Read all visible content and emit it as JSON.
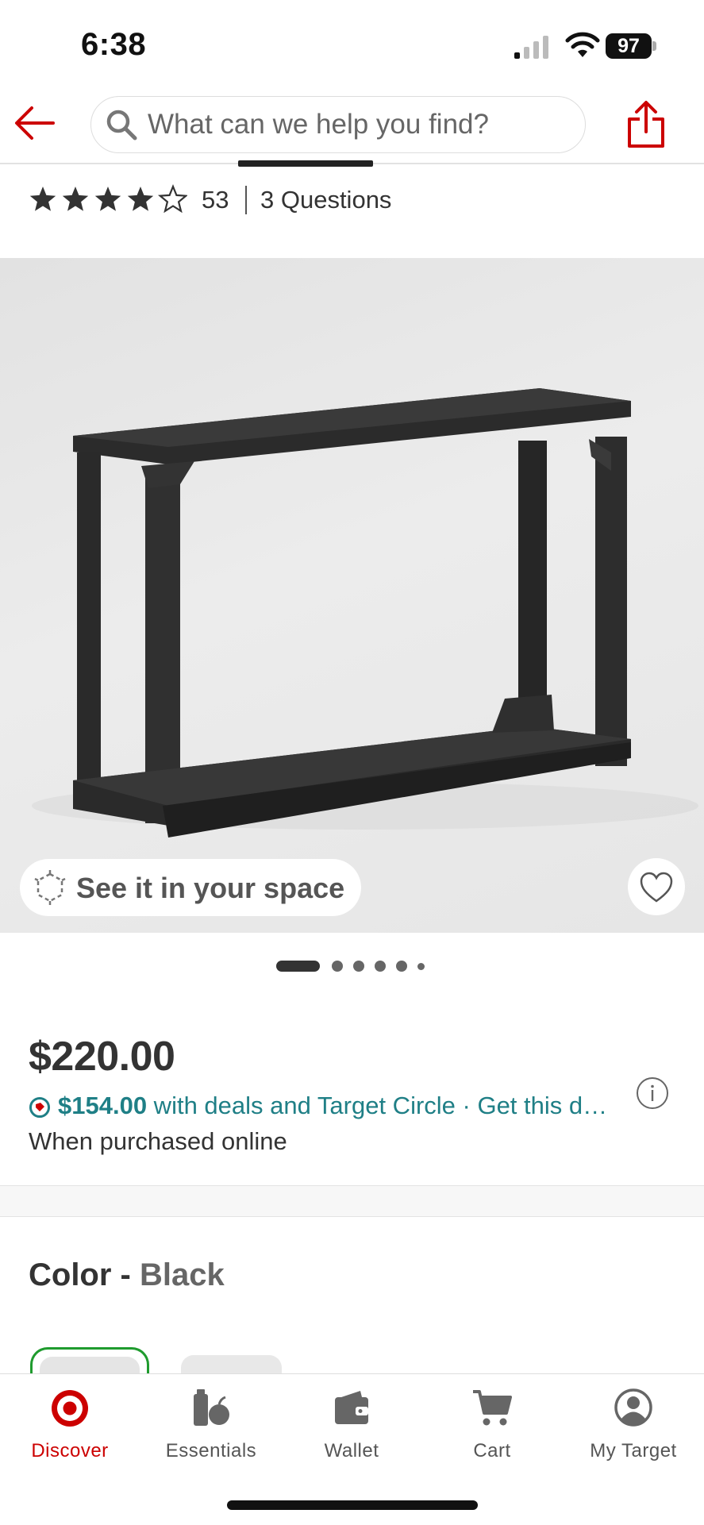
{
  "status_bar": {
    "time": "6:38",
    "battery": "97"
  },
  "header": {
    "search_placeholder": "What can we help you find?"
  },
  "rating": {
    "stars": 4,
    "max_stars": 5,
    "count": "53",
    "questions": "3 Questions"
  },
  "hero": {
    "see_in_space_label": "See it in your space",
    "slide_index": 1,
    "slide_count": 6
  },
  "price": {
    "amount": "$220.00",
    "deal_price": "$154.00",
    "deal_text": " with deals and Target Circle · Get this d…",
    "purchase_note": "When purchased online"
  },
  "color": {
    "label": "Color",
    "separator": " - ",
    "value": "Black"
  },
  "tabs": [
    {
      "label": "Discover",
      "icon": "bullseye-icon",
      "active": true
    },
    {
      "label": "Essentials",
      "icon": "essentials-icon",
      "active": false
    },
    {
      "label": "Wallet",
      "icon": "wallet-icon",
      "active": false
    },
    {
      "label": "Cart",
      "icon": "cart-icon",
      "active": false
    },
    {
      "label": "My Target",
      "icon": "account-icon",
      "active": false
    }
  ],
  "colors": {
    "brand_red": "#cc0000",
    "deal_teal": "#1f7f86",
    "selected_swatch": "#1f9b2e"
  }
}
